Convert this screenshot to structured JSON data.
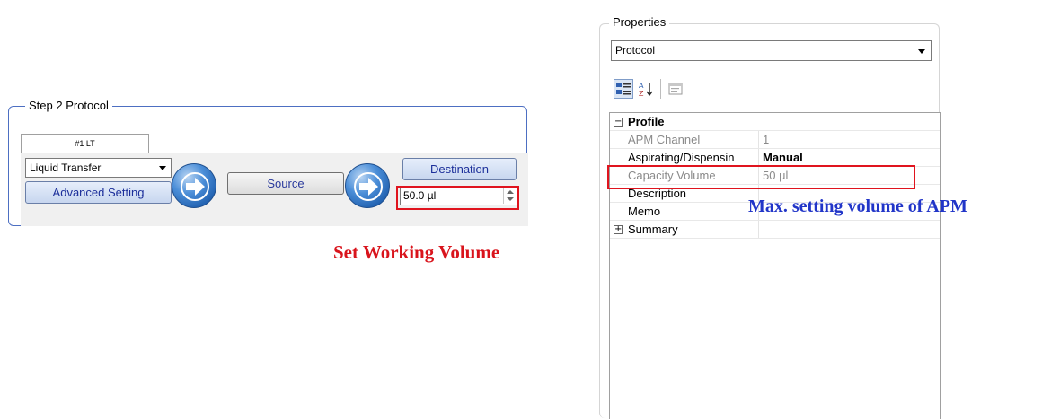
{
  "step_panel": {
    "title": "Step 2 Protocol",
    "tab_label": "#1 LT",
    "transfer_type": "Liquid Transfer",
    "advanced_button": "Advanced Setting",
    "source_button": "Source",
    "destination_button": "Destination",
    "volume_value": "50.0 µl",
    "icons": [
      "arrow-right-icon",
      "arrow-right-icon"
    ]
  },
  "annotations": {
    "set_working_volume": "Set Working Volume",
    "max_volume": "Max. setting volume of APM",
    "highlight_color": "#e0141e"
  },
  "properties": {
    "title": "Properties",
    "object_selector": "Protocol",
    "toolbar_icons": [
      "categorized-icon",
      "alphabetical-sort-icon",
      "property-pages-icon"
    ],
    "category": "Profile",
    "rows": [
      {
        "name": "APM Channel",
        "value": "1"
      },
      {
        "name": "Aspirating/Dispensin",
        "value": "Manual"
      },
      {
        "name": "Capacity Volume",
        "value": "50 µl"
      },
      {
        "name": "Description",
        "value": ""
      },
      {
        "name": "Memo",
        "value": ""
      }
    ],
    "collapsed_category": "Summary"
  }
}
